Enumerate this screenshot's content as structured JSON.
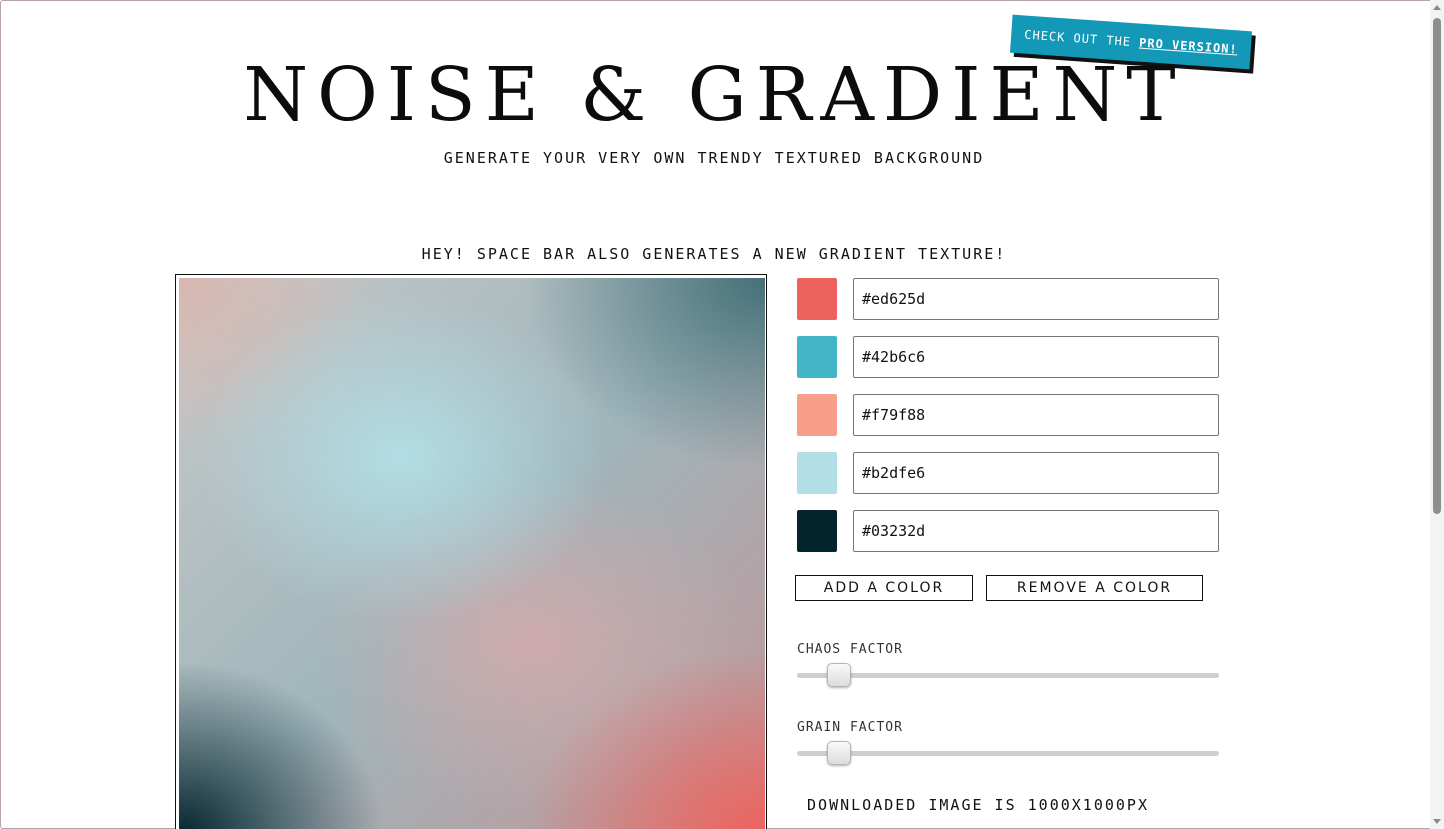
{
  "header": {
    "title": "NOISE & GRADIENT",
    "subtitle": "GENERATE YOUR VERY OWN TRENDY TEXTURED BACKGROUND",
    "pro_badge_prefix": "CHECK OUT THE ",
    "pro_badge_link": "PRO VERSION!",
    "pro_badge_color": "#1399b7"
  },
  "hint": "HEY! SPACE BAR ALSO GENERATES A NEW GRADIENT TEXTURE!",
  "colors": [
    {
      "hex": "#ed625d"
    },
    {
      "hex": "#42b6c6"
    },
    {
      "hex": "#f79f88"
    },
    {
      "hex": "#b2dfe6"
    },
    {
      "hex": "#03232d"
    }
  ],
  "buttons": {
    "add_color": "ADD A COLOR",
    "remove_color": "REMOVE A COLOR"
  },
  "sliders": {
    "chaos": {
      "label": "CHAOS FACTOR",
      "value_fraction": 0.1
    },
    "grain": {
      "label": "GRAIN FACTOR",
      "value_fraction": 0.1
    }
  },
  "download_note": "DOWNLOADED IMAGE IS 1000X1000PX"
}
